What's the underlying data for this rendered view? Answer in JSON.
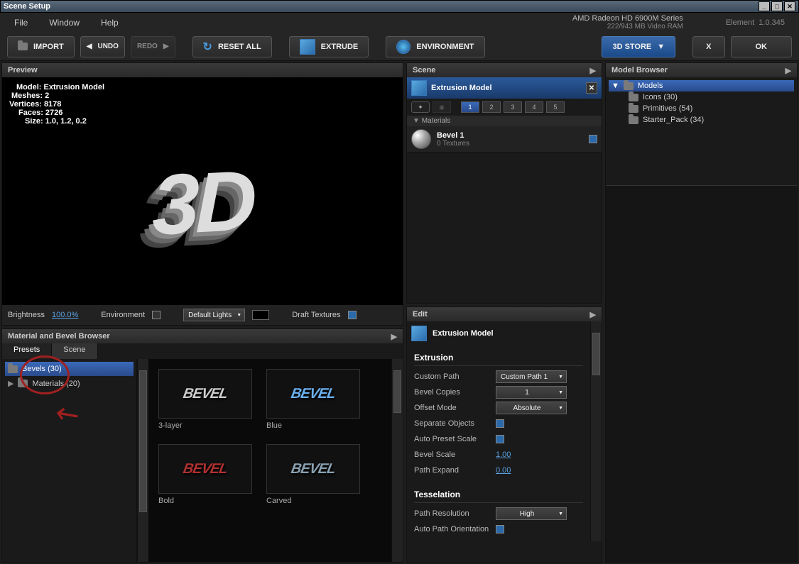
{
  "window": {
    "title": "Scene Setup"
  },
  "menu": {
    "file": "File",
    "window": "Window",
    "help": "Help"
  },
  "gpu": {
    "name": "AMD Radeon HD 6900M Series",
    "vram": "222/943 MB Video RAM"
  },
  "version": {
    "app": "Element",
    "num": "1.0.345"
  },
  "toolbar": {
    "import": "IMPORT",
    "undo": "UNDO",
    "redo": "REDO",
    "reset": "RESET ALL",
    "extrude": "EXTRUDE",
    "environment": "ENVIRONMENT",
    "store": "3D STORE",
    "x": "X",
    "ok": "OK"
  },
  "preview": {
    "title": "Preview",
    "stats": {
      "model_l": "Model:",
      "model_v": "Extrusion Model",
      "meshes_l": "Meshes:",
      "meshes_v": "2",
      "verts_l": "Vertices:",
      "verts_v": "8178",
      "faces_l": "Faces:",
      "faces_v": "2726",
      "size_l": "Size:",
      "size_v": "1.0, 1.2, 0.2"
    },
    "text3d": "3D",
    "footer": {
      "brightness_l": "Brightness",
      "brightness_v": "100.0%",
      "env_l": "Environment",
      "lights": "Default Lights",
      "draft_l": "Draft Textures"
    }
  },
  "scene": {
    "title": "Scene",
    "model": "Extrusion Model",
    "materials_header": "Materials",
    "mat1": {
      "name": "Bevel 1",
      "sub": "0 Textures"
    },
    "slots": {
      "s1": "1",
      "s2": "2",
      "s3": "3",
      "s4": "4",
      "s5": "5"
    }
  },
  "edit": {
    "title": "Edit",
    "model": "Extrusion Model",
    "extrusion": {
      "title": "Extrusion",
      "custom_path_l": "Custom Path",
      "custom_path_v": "Custom Path 1",
      "bevel_copies_l": "Bevel Copies",
      "bevel_copies_v": "1",
      "offset_mode_l": "Offset Mode",
      "offset_mode_v": "Absolute",
      "separate_l": "Separate Objects",
      "auto_preset_l": "Auto Preset Scale",
      "bevel_scale_l": "Bevel Scale",
      "bevel_scale_v": "1.00",
      "path_expand_l": "Path Expand",
      "path_expand_v": "0.00"
    },
    "tess": {
      "title": "Tesselation",
      "path_res_l": "Path Resolution",
      "path_res_v": "High",
      "auto_orient_l": "Auto Path Orientation"
    }
  },
  "model_browser": {
    "title": "Model Browser",
    "root": "Models",
    "items": {
      "icons": "Icons (30)",
      "prims": "Primitives (54)",
      "starter": "Starter_Pack (34)"
    }
  },
  "mat_browser": {
    "title": "Material and Bevel Browser",
    "tabs": {
      "presets": "Presets",
      "scene": "Scene"
    },
    "side": {
      "bevels": "Bevels (30)",
      "materials": "Materials (20)"
    },
    "thumbs": {
      "t1": "3-layer",
      "t2": "Blue",
      "t3": "Bold",
      "t4": "Carved"
    },
    "bevel_word": "BEVEL"
  }
}
